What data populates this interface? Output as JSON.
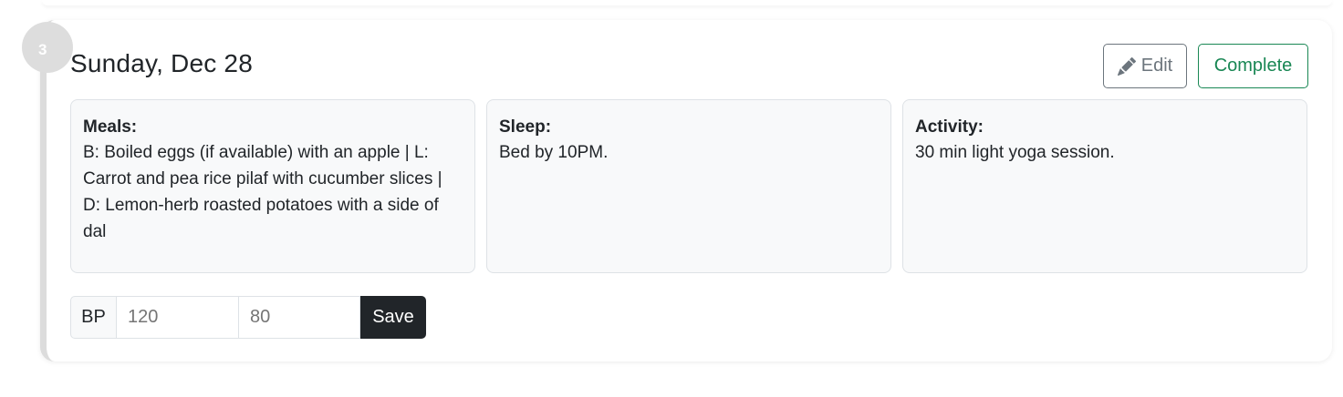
{
  "day": {
    "step_number": "3",
    "title": "Sunday, Dec 28",
    "edit_label": "Edit",
    "complete_label": "Complete",
    "edit_icon": "pencil-icon"
  },
  "meals": {
    "label": "Meals:",
    "text": "B: Boiled eggs (if available) with an apple | L: Carrot and pea rice pilaf with cucumber slices | D: Lemon-herb roasted potatoes with a side of dal"
  },
  "sleep": {
    "label": "Sleep:",
    "text": "Bed by 10PM."
  },
  "activity": {
    "label": "Activity:",
    "text": "30 min light yoga session."
  },
  "bp": {
    "label": "BP",
    "systolic_placeholder": "120",
    "diastolic_placeholder": "80",
    "save_label": "Save"
  },
  "colors": {
    "success": "#198754",
    "secondary": "#6c757d",
    "dark": "#212529",
    "timeline": "#dcdcdc"
  }
}
